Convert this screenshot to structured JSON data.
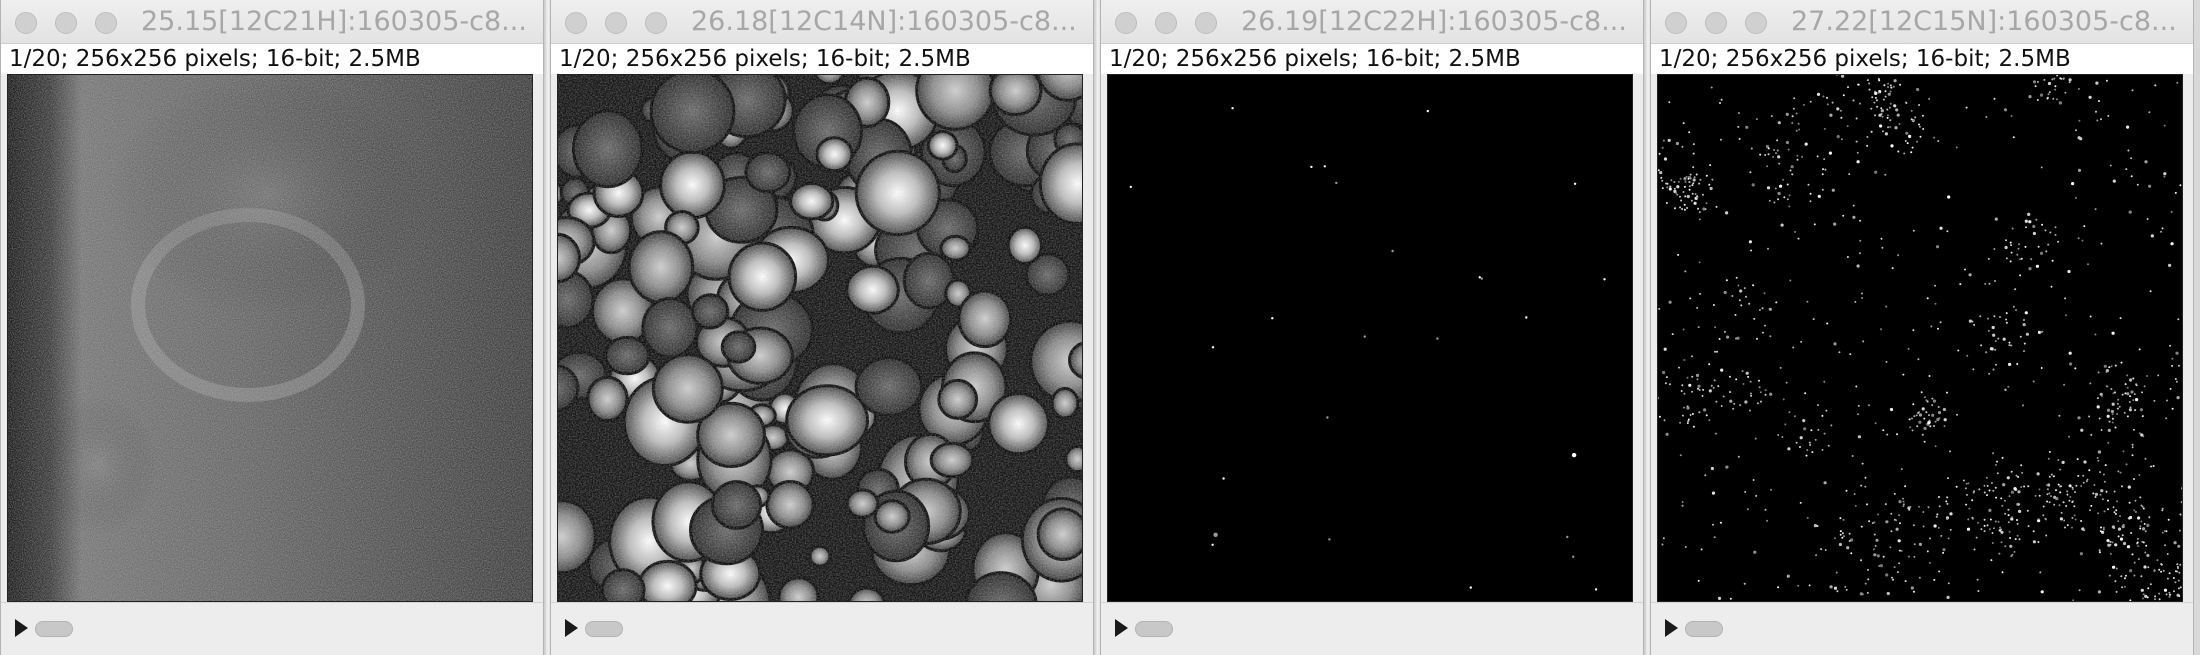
{
  "windows": [
    {
      "title": "25.15[12C21H]:160305-c8...",
      "info": "1/20; 256x256 pixels; 16-bit; 2.5MB"
    },
    {
      "title": "26.18[12C14N]:160305-c8...",
      "info": "1/20; 256x256 pixels; 16-bit; 2.5MB"
    },
    {
      "title": "26.19[12C22H]:160305-c8...",
      "info": "1/20; 256x256 pixels; 16-bit; 2.5MB"
    },
    {
      "title": "27.22[12C15N]:160305-c8...",
      "info": "1/20; 256x256 pixels; 16-bit; 2.5MB"
    }
  ],
  "icons": {
    "close": "close-button-icon",
    "minimize": "minimize-button-icon",
    "zoom": "zoom-button-icon",
    "play": "play-icon",
    "slider": "stack-slider-thumb"
  },
  "colors": {
    "window_bg": "#ececec",
    "title_text": "#a7a7a7",
    "info_text": "#111111",
    "image_bg": "#000000"
  }
}
